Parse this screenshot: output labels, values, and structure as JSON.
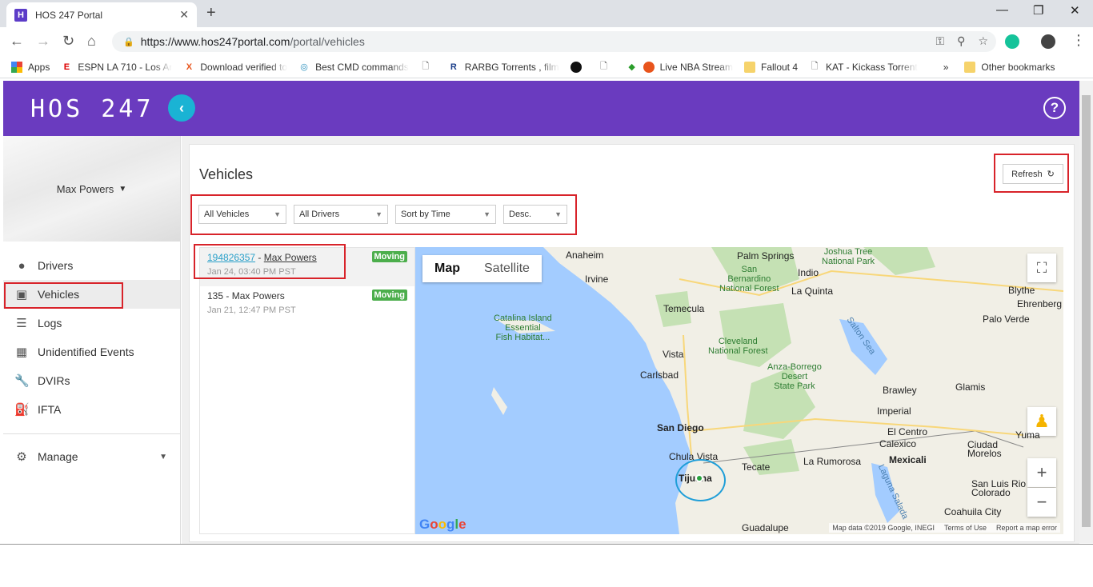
{
  "browser": {
    "tab_title": "HOS 247 Portal",
    "tab_favicon": "H",
    "url_host": "https://www.hos247portal.com",
    "url_path": "/portal/vehicles",
    "bookmarks": [
      {
        "label": "Apps",
        "icon": "apps-grid-icon"
      },
      {
        "label": "ESPN LA 710 - Los Ar",
        "icon": "espn-icon"
      },
      {
        "label": "Download verified to",
        "icon": "x-icon"
      },
      {
        "label": "Best CMD commands",
        "icon": "cmd-icon"
      },
      {
        "label": "",
        "icon": "page-icon"
      },
      {
        "label": "RARBG Torrents , film",
        "icon": "rarbg-icon"
      },
      {
        "label": "",
        "icon": "spotify-icon"
      },
      {
        "label": "",
        "icon": "page-icon"
      },
      {
        "label": "Live NBA Stream",
        "icon": "nba-icon"
      },
      {
        "label": "Fallout 4",
        "icon": "folder-icon"
      },
      {
        "label": "KAT - Kickass Torrent",
        "icon": "page-icon"
      }
    ],
    "bookmarks_more": "»",
    "other_bookmarks": "Other bookmarks"
  },
  "app": {
    "logo": "HOS 247",
    "help_label": "?",
    "collapse_label": "‹"
  },
  "sidebar": {
    "user_name": "Max Powers",
    "items": [
      {
        "label": "Drivers",
        "icon": "person-icon"
      },
      {
        "label": "Vehicles",
        "icon": "bus-icon"
      },
      {
        "label": "Logs",
        "icon": "list-icon"
      },
      {
        "label": "Unidentified Events",
        "icon": "calendar-icon"
      },
      {
        "label": "DVIRs",
        "icon": "wrench-icon"
      },
      {
        "label": "IFTA",
        "icon": "fuel-pump-icon"
      }
    ],
    "manage_label": "Manage"
  },
  "page": {
    "title": "Vehicles",
    "refresh_label": "Refresh",
    "filters": {
      "vehicles": "All Vehicles",
      "drivers": "All Drivers",
      "sort": "Sort by Time",
      "order": "Desc."
    }
  },
  "vehicles": [
    {
      "id": "194826357",
      "driver": "Max Powers",
      "time": "Jan 24, 03:40 PM PST",
      "status": "Moving",
      "linked": true
    },
    {
      "id": "135",
      "driver": "Max Powers",
      "time": "Jan 21, 12:47 PM PST",
      "status": "Moving",
      "linked": false
    }
  ],
  "map": {
    "type_map": "Map",
    "type_satellite": "Satellite",
    "google": "Google",
    "attribution": "Map data ©2019 Google, INEGI",
    "terms": "Terms of Use",
    "report": "Report a map error",
    "zoom_in": "+",
    "zoom_out": "−",
    "labels": {
      "anaheim": "Anaheim",
      "irvine": "Irvine",
      "palm_springs": "Palm Springs",
      "indio": "Indio",
      "joshua_tree": "Joshua Tree\nNational Park",
      "san_bernardino": "San\nBernardino\nNational Forest",
      "la_quinta": "La Quinta",
      "blythe": "Blythe",
      "ehrenberg": "Ehrenberg",
      "temecula": "Temecula",
      "catalina": "Catalina Island\nEssential\nFish Habitat...",
      "salton_sea": "Salton Sea",
      "palo_verde": "Palo Verde",
      "vista": "Vista",
      "cleveland": "Cleveland\nNational Forest",
      "carlsbad": "Carlsbad",
      "anza_borrego": "Anza-Borrego\nDesert\nState Park",
      "brawley": "Brawley",
      "glamis": "Glamis",
      "imperial": "Imperial",
      "san_diego": "San Diego",
      "el_centro": "El Centro",
      "calexico": "Calexico",
      "ciudad_morelos": "Ciudad\nMorelos",
      "yuma": "Yuma",
      "chula_vista": "Chula Vista",
      "tecate": "Tecate",
      "la_rumorosa": "La Rumorosa",
      "mexicali": "Mexicali",
      "tijuana": "Tijuana",
      "san_luis": "San Luis Rio\nColorado",
      "coahuila": "Coahuila City",
      "laguna_salada": "Laguna Salada",
      "guadalupe": "Guadalupe"
    }
  },
  "colors": {
    "header": "#6a3bbf",
    "accent": "#1ab3d4",
    "moving": "#4cae4c",
    "annotation_red": "#d8232a",
    "annotation_blue": "#1f9ed8"
  }
}
